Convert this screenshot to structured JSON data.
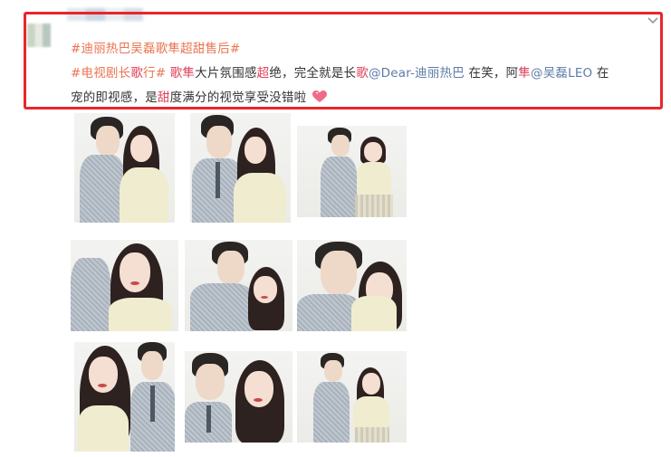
{
  "post": {
    "line1_topic": "#迪丽热巴吴磊歌隼超甜售后#",
    "line2_topic": "#电视剧长",
    "line2_topic_red": "歌",
    "line2_topic_end": "行#",
    "line2_red1": " 歌隼",
    "line2_plain1": "大片氛围感",
    "line2_red2": "超",
    "line2_plain2": "绝，完全就是长",
    "line2_red3": "歌",
    "line2_mention1": "@Dear-迪丽热巴",
    "line2_plain3": " 在笑，阿",
    "line2_red4": "隼",
    "line2_mention2": "@吴磊LEO",
    "line2_plain4": " 在",
    "line3_plain1": "宠的即视感，是",
    "line3_red1": "甜",
    "line3_plain2": "度满分的视觉享受没错啦"
  },
  "icons": {
    "chevron": "chevron-down-icon",
    "heart": "heart-emoji-icon"
  },
  "colors": {
    "topic": "#eb7350",
    "mention": "#5d7ca8",
    "highlight_box": "#e8262a",
    "keyword": "#e0415a"
  }
}
